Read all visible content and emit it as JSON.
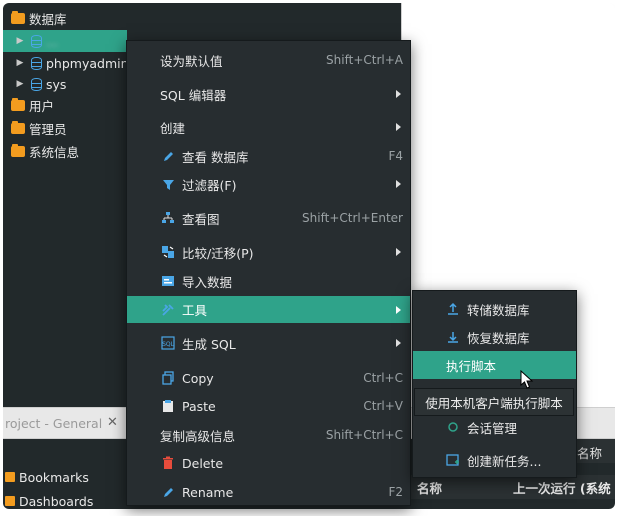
{
  "colors": {
    "accent": "#2fa38a",
    "panel": "#22292b",
    "menu_bg": "#272d30",
    "icon_blue": "#4aa6e6",
    "icon_orange": "#f39c1f",
    "icon_red": "#e74c3c"
  },
  "tree": {
    "items": [
      {
        "label": "数据库",
        "icon": "database-folder-icon",
        "expanded": true
      },
      {
        "label": "...",
        "icon": "database-icon",
        "selected": true,
        "obscured": true
      },
      {
        "label": "phpmyadmin",
        "icon": "database-icon"
      },
      {
        "label": "sys",
        "icon": "database-icon"
      },
      {
        "label": "用户",
        "icon": "user-folder-icon"
      },
      {
        "label": "管理员",
        "icon": "admin-folder-icon"
      },
      {
        "label": "系统信息",
        "icon": "info-folder-icon"
      }
    ]
  },
  "bottom": {
    "tab_label": "roject - General",
    "tab_close": "✕",
    "list": [
      "Bookmarks",
      "Dashboards"
    ],
    "table_headers": [
      "名称",
      "上一次运行 (系统"
    ],
    "right_header": "名称"
  },
  "menu": {
    "items": [
      {
        "label": "设为默认值",
        "shortcut": "Shift+Ctrl+A"
      },
      {
        "label": "SQL 编辑器",
        "submenu": true
      },
      {
        "label": "创建",
        "submenu": true
      },
      {
        "label": "查看 数据库",
        "icon": "pencil-icon",
        "shortcut": "F4"
      },
      {
        "label": "过滤器(F)",
        "icon": "filter-icon",
        "submenu": true
      },
      {
        "label": "查看图",
        "icon": "diagram-icon",
        "shortcut": "Shift+Ctrl+Enter"
      },
      {
        "label": "比较/迁移(P)",
        "icon": "compare-icon",
        "submenu": true
      },
      {
        "label": "导入数据",
        "icon": "import-icon"
      },
      {
        "label": "工具",
        "icon": "tools-icon",
        "submenu": true,
        "highlighted": true
      },
      {
        "label": "生成 SQL",
        "icon": "sql-icon",
        "submenu": true
      },
      {
        "label": "Copy",
        "icon": "copy-icon",
        "shortcut": "Ctrl+C"
      },
      {
        "label": "Paste",
        "icon": "paste-icon",
        "shortcut": "Ctrl+V"
      },
      {
        "label": "复制高级信息",
        "shortcut": "Shift+Ctrl+C"
      },
      {
        "label": "Delete",
        "icon": "delete-icon"
      },
      {
        "label": "Rename",
        "icon": "rename-icon",
        "shortcut": "F2"
      }
    ]
  },
  "submenu": {
    "items": [
      {
        "label": "转储数据库",
        "icon": "dump-icon"
      },
      {
        "label": "恢复数据库",
        "icon": "restore-icon"
      },
      {
        "label": "执行脚本",
        "highlighted": true
      },
      {
        "label": "会话管理",
        "icon": "session-icon"
      },
      {
        "label": "创建新任务...",
        "icon": "new-task-icon"
      }
    ]
  },
  "tooltip": "使用本机客户端执行脚本"
}
